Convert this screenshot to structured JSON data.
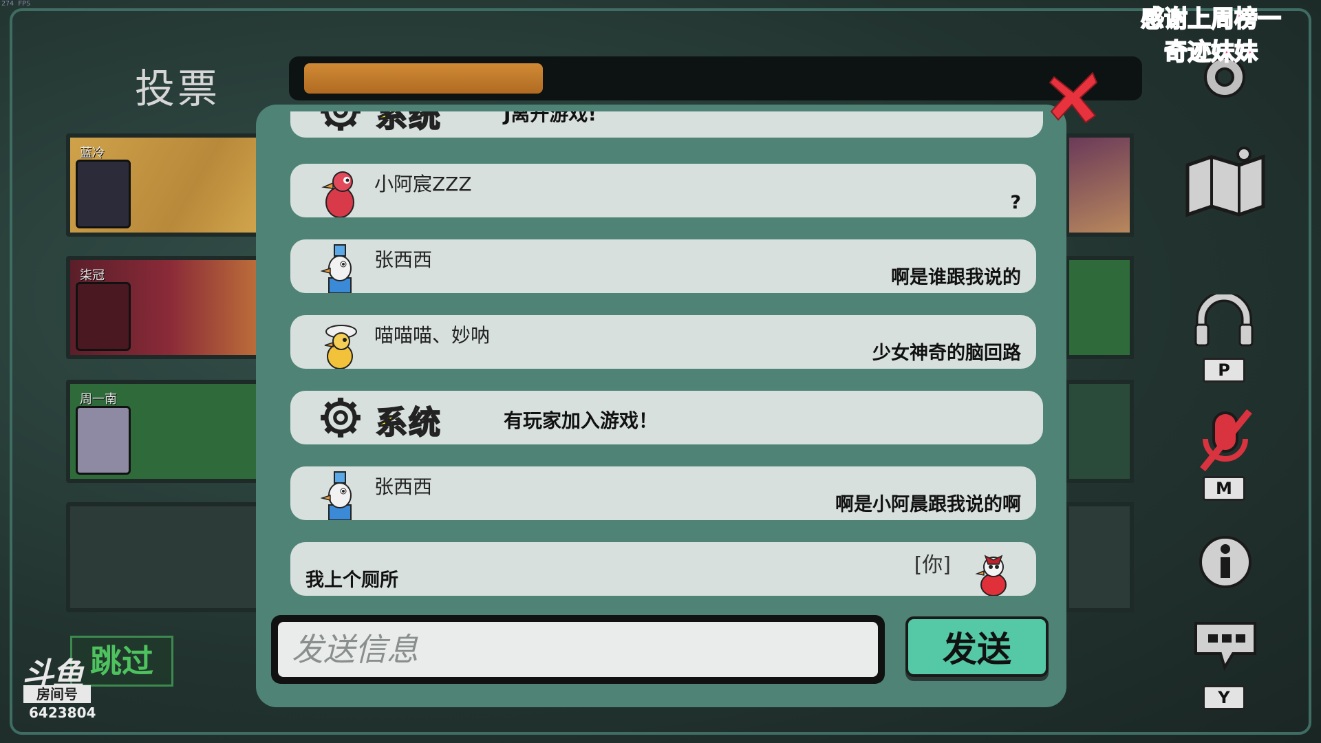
{
  "hud": {
    "fps_text": "274 FPS",
    "vote_title": "投票",
    "vote_progress": 0.29,
    "banner_line1": "感谢上周榜一",
    "banner_line2": "奇迹妹妹",
    "skip_label": "跳过",
    "platform_logo": "斗鱼",
    "room_label": "房间号",
    "room_number": "6423804"
  },
  "players": [
    {
      "name": "蓝冷"
    },
    {
      "name": "柒冠"
    },
    {
      "name": "周一南"
    }
  ],
  "chat": {
    "messages": [
      {
        "type": "system",
        "label": "系统",
        "text": "J离开游戏!"
      },
      {
        "type": "player",
        "sender": "小阿宸ZZZ",
        "text": "?",
        "avatar": "red-goose-avatar"
      },
      {
        "type": "player",
        "sender": "张西西",
        "text": "啊是谁跟我说的",
        "avatar": "blue-goose-avatar"
      },
      {
        "type": "player",
        "sender": "喵喵喵、妙呐",
        "text": "少女神奇的脑回路",
        "avatar": "yellow-goose-avatar"
      },
      {
        "type": "system",
        "label": "系统",
        "text": "有玩家加入游戏！"
      },
      {
        "type": "player",
        "sender": "张西西",
        "text": "啊是小阿晨跟我说的啊",
        "avatar": "blue-goose-avatar"
      },
      {
        "type": "self",
        "you_tag": "[你]",
        "text": "我上个厕所",
        "avatar": "white-goose-avatar"
      }
    ],
    "input_placeholder": "发送信息",
    "send_label": "发送"
  },
  "sidebar": {
    "voice_key": "P",
    "mute_key": "M",
    "chat_key": "Y"
  },
  "colors": {
    "panel": "#4e8375",
    "bubble": "#d7e0dc",
    "system_label": "#ffe31a",
    "send_button": "#55c8a6",
    "close": "#e8333f",
    "progress": "#c47c2c"
  }
}
